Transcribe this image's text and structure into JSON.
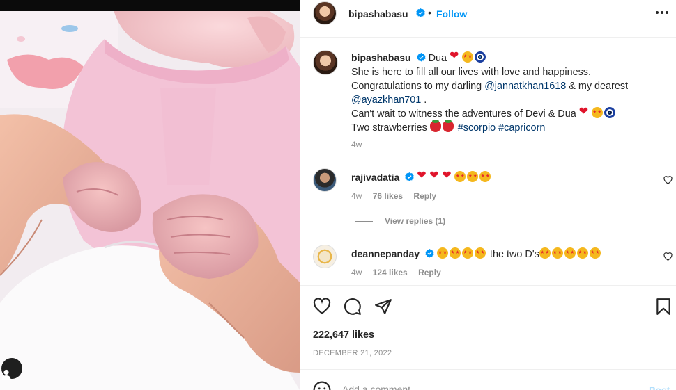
{
  "post": {
    "author": "bipashabasu",
    "follow_label": "Follow",
    "dot": "•",
    "icons": {
      "verified": "verified-badge-icon",
      "more": "more-options-icon",
      "user_tags": "user-tag-icon"
    }
  },
  "caption": {
    "username": "bipashabasu",
    "line1_text": "Dua",
    "line2": "She is here to fill all our lives with love and happiness.",
    "line3_pre": "Congratulations to my darling ",
    "mention1": "@jannatkhan1618",
    "line3_mid": " & my dearest",
    "mention2": "@ayazkhan701",
    "line4_post": " .",
    "line5": "Can't wait to witness the adventures of Devi & Dua",
    "line6_pre": "Two strawberries",
    "tag1": "#scorpio",
    "tag2": "#capricorn",
    "time": "4w"
  },
  "comments": [
    {
      "username": "rajivadatia",
      "text": "",
      "emojis": [
        "red-heart",
        "red-heart",
        "red-heart",
        "star-struck",
        "star-struck",
        "star-struck"
      ],
      "time": "4w",
      "likes": "76 likes",
      "reply": "Reply"
    },
    {
      "username": "deannepanday",
      "text_mid": " the two D's",
      "time": "4w",
      "likes": "124 likes",
      "reply": "Reply"
    }
  ],
  "view_replies": "View replies (1)",
  "actions": {
    "likes_count": "222,647 likes",
    "date": "DECEMBER 21, 2022",
    "icons": [
      "heart-icon",
      "comment-icon",
      "share-icon",
      "bookmark-icon"
    ]
  },
  "add_comment": {
    "placeholder": "Add a comment…",
    "post_label": "Post"
  },
  "colors": {
    "accent": "#0095f6",
    "link": "#00376b",
    "muted": "#8e8e8e",
    "text": "#262626"
  }
}
